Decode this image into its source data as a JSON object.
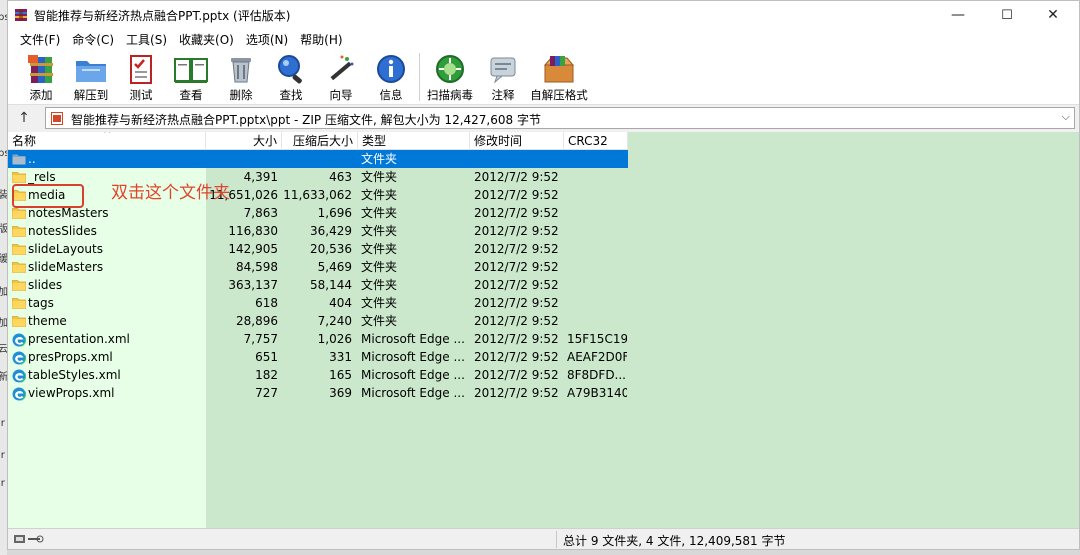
{
  "window": {
    "title": "智能推荐与新经济热点融合PPT.pptx (评估版本)",
    "controls": {
      "minimize": "—",
      "maximize": "☐",
      "close": "✕"
    }
  },
  "background_window": {
    "visible_fragments": [
      "ps",
      "ps",
      "装",
      "版",
      "缓",
      "加",
      "加",
      "云",
      "新",
      "ir",
      "ir",
      "ir"
    ]
  },
  "menu": [
    "文件(F)",
    "命令(C)",
    "工具(S)",
    "收藏夹(O)",
    "选项(N)",
    "帮助(H)"
  ],
  "toolbar": {
    "buttons": [
      {
        "label": "添加",
        "icon": "add-archive-icon"
      },
      {
        "label": "解压到",
        "icon": "extract-to-folder-icon"
      },
      {
        "label": "测试",
        "icon": "test-checklist-icon"
      },
      {
        "label": "查看",
        "icon": "view-book-icon"
      },
      {
        "label": "删除",
        "icon": "trash-icon"
      },
      {
        "label": "查找",
        "icon": "magnifier-icon"
      },
      {
        "label": "向导",
        "icon": "magic-wand-icon"
      },
      {
        "label": "信息",
        "icon": "info-icon"
      },
      {
        "label": "扫描病毒",
        "icon": "virus-scan-icon"
      },
      {
        "label": "注释",
        "icon": "comment-icon"
      },
      {
        "label": "自解压格式",
        "icon": "sfx-box-icon"
      }
    ]
  },
  "address": {
    "up_label": "↑",
    "path": "智能推荐与新经济热点融合PPT.pptx\\ppt - ZIP 压缩文件, 解包大小为 12,427,608 字节"
  },
  "columns": [
    "名称",
    "大小",
    "压缩后大小",
    "类型",
    "修改时间",
    "CRC32"
  ],
  "rows": [
    {
      "name": "..",
      "size": "",
      "packed": "",
      "type": "文件夹",
      "modified": "",
      "crc": "",
      "kind": "up",
      "selected": true
    },
    {
      "name": "_rels",
      "size": "4,391",
      "packed": "463",
      "type": "文件夹",
      "modified": "2012/7/2 9:52",
      "crc": "",
      "kind": "folder"
    },
    {
      "name": "media",
      "size": "11,651,026",
      "packed": "11,633,062",
      "type": "文件夹",
      "modified": "2012/7/2 9:52",
      "crc": "",
      "kind": "folder"
    },
    {
      "name": "notesMasters",
      "size": "7,863",
      "packed": "1,696",
      "type": "文件夹",
      "modified": "2012/7/2 9:52",
      "crc": "",
      "kind": "folder"
    },
    {
      "name": "notesSlides",
      "size": "116,830",
      "packed": "36,429",
      "type": "文件夹",
      "modified": "2012/7/2 9:52",
      "crc": "",
      "kind": "folder"
    },
    {
      "name": "slideLayouts",
      "size": "142,905",
      "packed": "20,536",
      "type": "文件夹",
      "modified": "2012/7/2 9:52",
      "crc": "",
      "kind": "folder"
    },
    {
      "name": "slideMasters",
      "size": "84,598",
      "packed": "5,469",
      "type": "文件夹",
      "modified": "2012/7/2 9:52",
      "crc": "",
      "kind": "folder"
    },
    {
      "name": "slides",
      "size": "363,137",
      "packed": "58,144",
      "type": "文件夹",
      "modified": "2012/7/2 9:52",
      "crc": "",
      "kind": "folder"
    },
    {
      "name": "tags",
      "size": "618",
      "packed": "404",
      "type": "文件夹",
      "modified": "2012/7/2 9:52",
      "crc": "",
      "kind": "folder"
    },
    {
      "name": "theme",
      "size": "28,896",
      "packed": "7,240",
      "type": "文件夹",
      "modified": "2012/7/2 9:52",
      "crc": "",
      "kind": "folder"
    },
    {
      "name": "presentation.xml",
      "size": "7,757",
      "packed": "1,026",
      "type": "Microsoft Edge ...",
      "modified": "2012/7/2 9:52",
      "crc": "15F15C19",
      "kind": "edge"
    },
    {
      "name": "presProps.xml",
      "size": "651",
      "packed": "331",
      "type": "Microsoft Edge ...",
      "modified": "2012/7/2 9:52",
      "crc": "AEAF2D0F",
      "kind": "edge"
    },
    {
      "name": "tableStyles.xml",
      "size": "182",
      "packed": "165",
      "type": "Microsoft Edge ...",
      "modified": "2012/7/2 9:52",
      "crc": "8F8DFD...",
      "kind": "edge"
    },
    {
      "name": "viewProps.xml",
      "size": "727",
      "packed": "369",
      "type": "Microsoft Edge ...",
      "modified": "2012/7/2 9:52",
      "crc": "A79B3140",
      "kind": "edge"
    }
  ],
  "annotation": {
    "text": "双击这个文件夹",
    "color": "#e0452b"
  },
  "status": {
    "summary": "总计 9 文件夹, 4 文件, 12,409,581 字节"
  },
  "colors": {
    "selection": "#0078d7",
    "name_column_bg": "#e6ffe6",
    "other_columns_bg": "#cce8cc",
    "folder": "#f5c542"
  }
}
